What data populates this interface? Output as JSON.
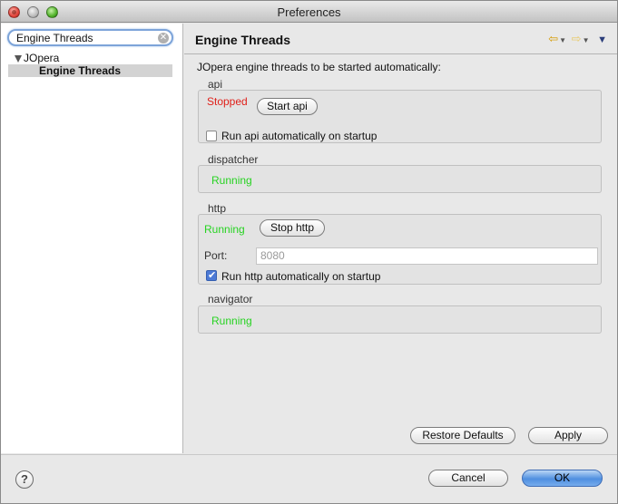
{
  "window": {
    "title": "Preferences"
  },
  "sidebar": {
    "search_value": "Engine Threads",
    "tree": {
      "parent": "JOpera",
      "child": "Engine Threads"
    }
  },
  "page": {
    "title": "Engine Threads",
    "description": "JOpera engine threads to be started automatically:"
  },
  "threads": {
    "api": {
      "label": "api",
      "status": "Stopped",
      "button": "Start api",
      "autostart_label": "Run api automatically on startup",
      "autostart": false
    },
    "dispatcher": {
      "label": "dispatcher",
      "status": "Running"
    },
    "http": {
      "label": "http",
      "status": "Running",
      "button": "Stop http",
      "port_label": "Port:",
      "port_value": "8080",
      "autostart_label": "Run http automatically on startup",
      "autostart": true
    },
    "navigator": {
      "label": "navigator",
      "status": "Running"
    }
  },
  "buttons": {
    "restore_defaults": "Restore Defaults",
    "apply": "Apply",
    "cancel": "Cancel",
    "ok": "OK",
    "help": "?"
  },
  "colors": {
    "stopped": "#e0201a",
    "running": "#27d322",
    "accent": "#4f8fe0"
  },
  "icons": {
    "back": "back-arrow-icon",
    "forward": "forward-arrow-icon",
    "menu": "view-menu-icon",
    "help": "help-icon",
    "clear": "clear-search-icon"
  }
}
